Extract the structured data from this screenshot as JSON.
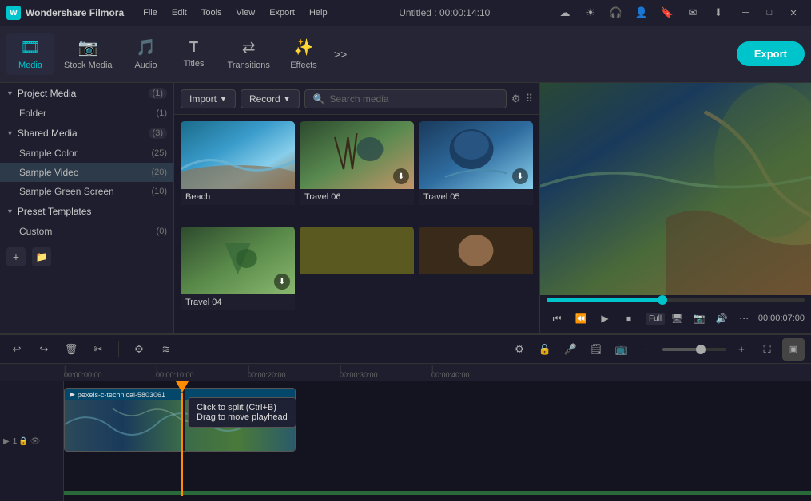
{
  "app": {
    "name": "Wondershare Filmora",
    "title": "Untitled : 00:00:14:10"
  },
  "menu": {
    "items": [
      "File",
      "Edit",
      "Tools",
      "View",
      "Export",
      "Help"
    ]
  },
  "titlebar": {
    "icons": [
      "cloud-icon",
      "sun-icon",
      "headphone-icon",
      "user-icon",
      "bookmark-icon",
      "mail-icon",
      "download-icon"
    ]
  },
  "toolbar": {
    "items": [
      {
        "id": "media",
        "label": "Media",
        "icon": "🎞"
      },
      {
        "id": "stock",
        "label": "Stock Media",
        "icon": "📷"
      },
      {
        "id": "audio",
        "label": "Audio",
        "icon": "🎵"
      },
      {
        "id": "titles",
        "label": "Titles",
        "icon": "T"
      },
      {
        "id": "transitions",
        "label": "Transitions",
        "icon": "⇄"
      },
      {
        "id": "effects",
        "label": "Effects",
        "icon": "✨"
      }
    ],
    "more_icon": ">>",
    "export_label": "Export"
  },
  "left_panel": {
    "project_media": {
      "title": "Project Media",
      "count": "(1)",
      "items": [
        {
          "label": "Folder",
          "count": "(1)"
        }
      ]
    },
    "shared_media": {
      "title": "Shared Media",
      "count": "(3)",
      "items": [
        {
          "label": "Sample Color",
          "count": "(25)"
        },
        {
          "label": "Sample Video",
          "count": "(20)",
          "active": true
        },
        {
          "label": "Sample Green Screen",
          "count": "(10)"
        }
      ]
    },
    "preset_templates": {
      "title": "Preset Templates",
      "items": [
        {
          "label": "Custom",
          "count": "(0)"
        }
      ]
    },
    "bottom_icons": [
      "add-icon",
      "folder-icon"
    ]
  },
  "content_toolbar": {
    "import_label": "Import",
    "record_label": "Record",
    "search_placeholder": "Search media"
  },
  "media_items": [
    {
      "id": "beach",
      "label": "Beach",
      "thumb_class": "thumb-beach"
    },
    {
      "id": "travel06",
      "label": "Travel 06",
      "thumb_class": "thumb-travel06"
    },
    {
      "id": "travel05",
      "label": "Travel 05",
      "thumb_class": "thumb-travel05"
    },
    {
      "id": "travel04",
      "label": "Travel 04",
      "thumb_class": "thumb-travel04"
    },
    {
      "id": "partial1",
      "label": "",
      "thumb_class": "thumb-partial"
    },
    {
      "id": "partial2",
      "label": "",
      "thumb_class": "thumb-partial"
    }
  ],
  "preview": {
    "time": "00:00:07:00",
    "full_label": "Full",
    "progress_percent": 45
  },
  "timeline_toolbar": {
    "buttons": [
      "undo",
      "redo",
      "delete",
      "cut",
      "settings",
      "audio-wave"
    ],
    "zoom_minus": "−",
    "zoom_plus": "+",
    "record_btn": "⏺",
    "add_btn": "+"
  },
  "timeline": {
    "ruler_marks": [
      "00:00:00:00",
      "00:00:10:00",
      "00:00:20:00",
      "00:00:30:00",
      "00:00:40:00"
    ],
    "clip_name": "pexels-c-technical-5803061",
    "playhead_time": "00:00:10:00"
  },
  "split_tooltip": {
    "line1": "Click to split (Ctrl+B)",
    "line2": "Drag to move playhead"
  }
}
